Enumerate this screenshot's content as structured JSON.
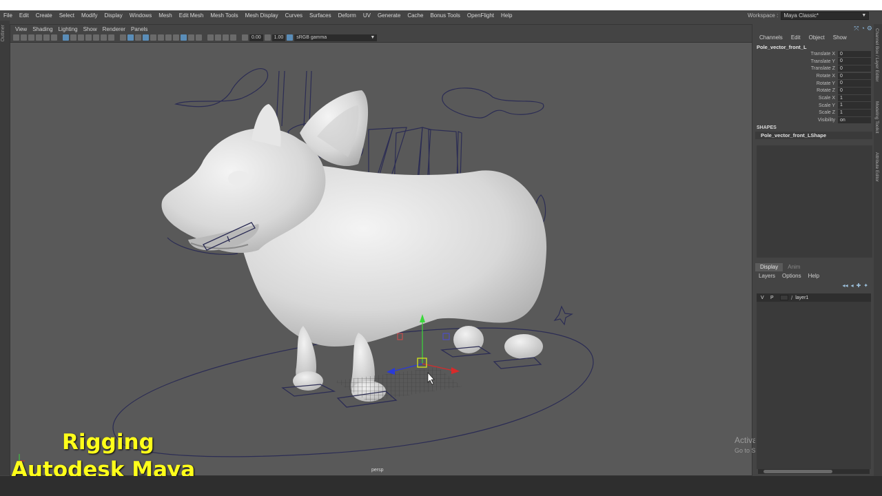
{
  "menubar": {
    "items": [
      "File",
      "Edit",
      "Create",
      "Select",
      "Modify",
      "Display",
      "Windows",
      "Mesh",
      "Edit Mesh",
      "Mesh Tools",
      "Mesh Display",
      "Curves",
      "Surfaces",
      "Deform",
      "UV",
      "Generate",
      "Cache",
      "Bonus Tools",
      "OpenFlight",
      "Help"
    ],
    "workspace_label": "Workspace :",
    "workspace_value": "Maya Classic*"
  },
  "left_strip": {
    "label": "Outliner"
  },
  "viewport": {
    "panel_menu": [
      "View",
      "Shading",
      "Lighting",
      "Show",
      "Renderer",
      "Panels"
    ],
    "exposure": "0.00",
    "gamma": "1.00",
    "color_space": "sRGB gamma",
    "camera_label": "persp"
  },
  "channel_box": {
    "menu": [
      "Channels",
      "Edit",
      "Object",
      "Show"
    ],
    "object_name": "Pole_vector_front_L",
    "attributes": [
      {
        "label": "Translate X",
        "value": "0"
      },
      {
        "label": "Translate Y",
        "value": "0"
      },
      {
        "label": "Translate Z",
        "value": "0"
      },
      {
        "label": "Rotate X",
        "value": "0"
      },
      {
        "label": "Rotate Y",
        "value": "0"
      },
      {
        "label": "Rotate Z",
        "value": "0"
      },
      {
        "label": "Scale X",
        "value": "1"
      },
      {
        "label": "Scale Y",
        "value": "1"
      },
      {
        "label": "Scale Z",
        "value": "1"
      },
      {
        "label": "Visibility",
        "value": "on"
      }
    ],
    "shapes_header": "SHAPES",
    "shape_name": "Pole_vector_front_LShape"
  },
  "layer_editor": {
    "tabs": [
      "Display",
      "Anim"
    ],
    "menu": [
      "Layers",
      "Options",
      "Help"
    ],
    "layers": [
      {
        "v": "V",
        "p": "P",
        "name": "layer1"
      }
    ]
  },
  "side_tabs": [
    "Channel Box / Layer Editor",
    "Modeling Toolkit",
    "Attribute Editor"
  ],
  "overlay": {
    "line1": "Rigging",
    "line2": "Autodesk Maya"
  },
  "watermark": {
    "line1": "Activate Windows",
    "line2": "Go to Settings to activate Windows."
  }
}
